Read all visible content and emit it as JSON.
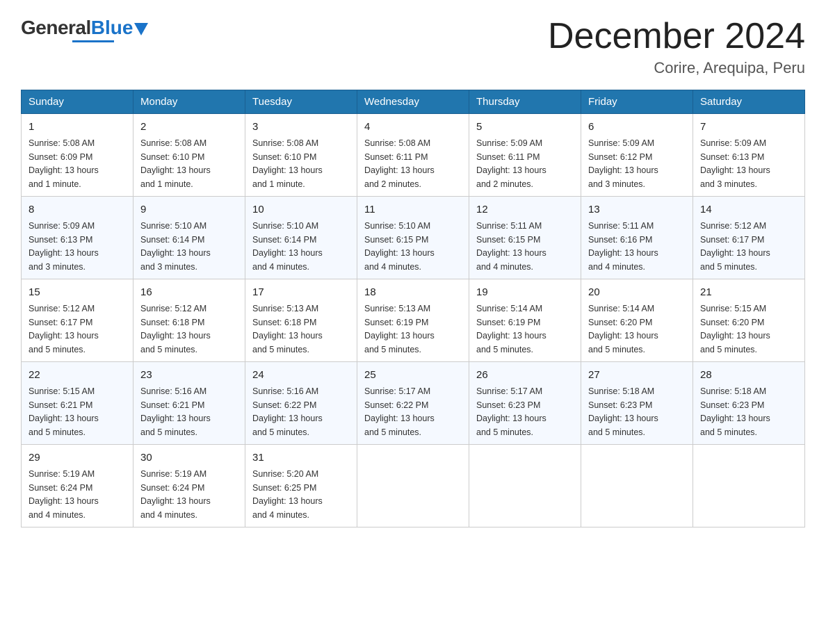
{
  "logo": {
    "general": "General",
    "blue": "Blue"
  },
  "title": "December 2024",
  "subtitle": "Corire, Arequipa, Peru",
  "days_header": [
    "Sunday",
    "Monday",
    "Tuesday",
    "Wednesday",
    "Thursday",
    "Friday",
    "Saturday"
  ],
  "weeks": [
    [
      {
        "day": "1",
        "sunrise": "5:08 AM",
        "sunset": "6:09 PM",
        "daylight": "13 hours and 1 minute."
      },
      {
        "day": "2",
        "sunrise": "5:08 AM",
        "sunset": "6:10 PM",
        "daylight": "13 hours and 1 minute."
      },
      {
        "day": "3",
        "sunrise": "5:08 AM",
        "sunset": "6:10 PM",
        "daylight": "13 hours and 1 minute."
      },
      {
        "day": "4",
        "sunrise": "5:08 AM",
        "sunset": "6:11 PM",
        "daylight": "13 hours and 2 minutes."
      },
      {
        "day": "5",
        "sunrise": "5:09 AM",
        "sunset": "6:11 PM",
        "daylight": "13 hours and 2 minutes."
      },
      {
        "day": "6",
        "sunrise": "5:09 AM",
        "sunset": "6:12 PM",
        "daylight": "13 hours and 3 minutes."
      },
      {
        "day": "7",
        "sunrise": "5:09 AM",
        "sunset": "6:13 PM",
        "daylight": "13 hours and 3 minutes."
      }
    ],
    [
      {
        "day": "8",
        "sunrise": "5:09 AM",
        "sunset": "6:13 PM",
        "daylight": "13 hours and 3 minutes."
      },
      {
        "day": "9",
        "sunrise": "5:10 AM",
        "sunset": "6:14 PM",
        "daylight": "13 hours and 3 minutes."
      },
      {
        "day": "10",
        "sunrise": "5:10 AM",
        "sunset": "6:14 PM",
        "daylight": "13 hours and 4 minutes."
      },
      {
        "day": "11",
        "sunrise": "5:10 AM",
        "sunset": "6:15 PM",
        "daylight": "13 hours and 4 minutes."
      },
      {
        "day": "12",
        "sunrise": "5:11 AM",
        "sunset": "6:15 PM",
        "daylight": "13 hours and 4 minutes."
      },
      {
        "day": "13",
        "sunrise": "5:11 AM",
        "sunset": "6:16 PM",
        "daylight": "13 hours and 4 minutes."
      },
      {
        "day": "14",
        "sunrise": "5:12 AM",
        "sunset": "6:17 PM",
        "daylight": "13 hours and 5 minutes."
      }
    ],
    [
      {
        "day": "15",
        "sunrise": "5:12 AM",
        "sunset": "6:17 PM",
        "daylight": "13 hours and 5 minutes."
      },
      {
        "day": "16",
        "sunrise": "5:12 AM",
        "sunset": "6:18 PM",
        "daylight": "13 hours and 5 minutes."
      },
      {
        "day": "17",
        "sunrise": "5:13 AM",
        "sunset": "6:18 PM",
        "daylight": "13 hours and 5 minutes."
      },
      {
        "day": "18",
        "sunrise": "5:13 AM",
        "sunset": "6:19 PM",
        "daylight": "13 hours and 5 minutes."
      },
      {
        "day": "19",
        "sunrise": "5:14 AM",
        "sunset": "6:19 PM",
        "daylight": "13 hours and 5 minutes."
      },
      {
        "day": "20",
        "sunrise": "5:14 AM",
        "sunset": "6:20 PM",
        "daylight": "13 hours and 5 minutes."
      },
      {
        "day": "21",
        "sunrise": "5:15 AM",
        "sunset": "6:20 PM",
        "daylight": "13 hours and 5 minutes."
      }
    ],
    [
      {
        "day": "22",
        "sunrise": "5:15 AM",
        "sunset": "6:21 PM",
        "daylight": "13 hours and 5 minutes."
      },
      {
        "day": "23",
        "sunrise": "5:16 AM",
        "sunset": "6:21 PM",
        "daylight": "13 hours and 5 minutes."
      },
      {
        "day": "24",
        "sunrise": "5:16 AM",
        "sunset": "6:22 PM",
        "daylight": "13 hours and 5 minutes."
      },
      {
        "day": "25",
        "sunrise": "5:17 AM",
        "sunset": "6:22 PM",
        "daylight": "13 hours and 5 minutes."
      },
      {
        "day": "26",
        "sunrise": "5:17 AM",
        "sunset": "6:23 PM",
        "daylight": "13 hours and 5 minutes."
      },
      {
        "day": "27",
        "sunrise": "5:18 AM",
        "sunset": "6:23 PM",
        "daylight": "13 hours and 5 minutes."
      },
      {
        "day": "28",
        "sunrise": "5:18 AM",
        "sunset": "6:23 PM",
        "daylight": "13 hours and 5 minutes."
      }
    ],
    [
      {
        "day": "29",
        "sunrise": "5:19 AM",
        "sunset": "6:24 PM",
        "daylight": "13 hours and 4 minutes."
      },
      {
        "day": "30",
        "sunrise": "5:19 AM",
        "sunset": "6:24 PM",
        "daylight": "13 hours and 4 minutes."
      },
      {
        "day": "31",
        "sunrise": "5:20 AM",
        "sunset": "6:25 PM",
        "daylight": "13 hours and 4 minutes."
      },
      null,
      null,
      null,
      null
    ]
  ],
  "labels": {
    "sunrise": "Sunrise:",
    "sunset": "Sunset:",
    "daylight": "Daylight:"
  }
}
